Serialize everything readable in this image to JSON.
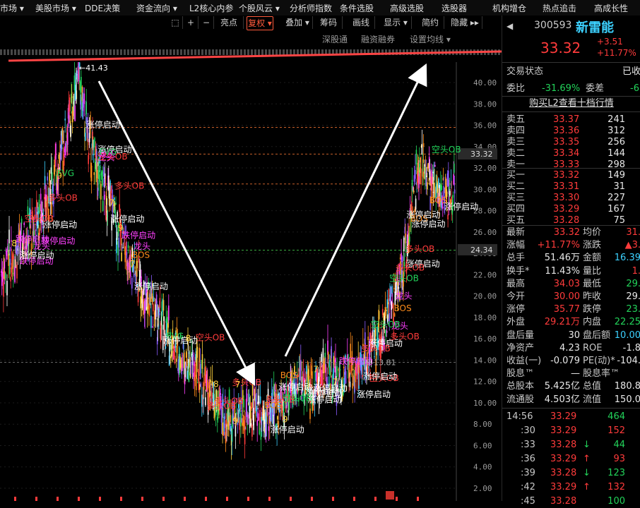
{
  "menu": [
    "市场 ▾",
    "美股市场 ▾",
    "DDE决策",
    "资金流向 ▾",
    "L2核心内参",
    "个股风云 ▾",
    "分析师指数",
    "条件选股",
    "高级选股",
    "选股器",
    "机构增仓",
    "热点追击",
    "高成长性"
  ],
  "toolbar": {
    "buttons": [
      "⬚",
      "+",
      "−",
      "亮点",
      "复权 ▾",
      "叠加 ▾",
      "筹码",
      "画线",
      "显示 ▾",
      "简约",
      "隐藏 ▸▸"
    ],
    "selected_label": "复权 ▾"
  },
  "subbar": {
    "items": [
      "深股通",
      "融资融券",
      "设置均线 ▾"
    ]
  },
  "chart": {
    "y_ticks": [
      "40.00",
      "38.00",
      "36.00",
      "34.00",
      "32.00",
      "30.00",
      "28.00",
      "26.00",
      "24.00",
      "22.00",
      "20.00",
      "18.00",
      "16.00",
      "14.00",
      "12.00",
      "10.00",
      "8.00",
      "6.00",
      "4.00",
      "2.00"
    ],
    "price_tag": "33.32",
    "price_tag2": "24.34",
    "high_label": "←41.43",
    "low_label": "8-13.81",
    "annotations": [
      "FVG",
      "空头OB",
      "多头OB",
      "涨停启动",
      "跌停启动",
      "龙头",
      "BOS",
      "7",
      "8",
      "9",
      "多头OB",
      "空头OB",
      "涨停启动"
    ]
  },
  "stock": {
    "code": "300593",
    "name": "新雷能",
    "price": "33.32",
    "change": "+3.51",
    "change_pct": "+11.77%",
    "trade_status_label": "交易状态",
    "trade_status_value": "已收",
    "webi_label": "委比",
    "webi_value": "-31.69%",
    "weicha_label": "委差",
    "weicha_value": "-6",
    "l2_link": "购买L2查看十档行情"
  },
  "asks": [
    {
      "label": "卖五",
      "price": "33.37",
      "vol": "241"
    },
    {
      "label": "卖四",
      "price": "33.36",
      "vol": "312"
    },
    {
      "label": "卖三",
      "price": "33.35",
      "vol": "256"
    },
    {
      "label": "卖二",
      "price": "33.34",
      "vol": "144"
    },
    {
      "label": "卖一",
      "price": "33.33",
      "vol": "298"
    }
  ],
  "bids": [
    {
      "label": "买一",
      "price": "33.32",
      "vol": "149"
    },
    {
      "label": "买二",
      "price": "33.31",
      "vol": "31"
    },
    {
      "label": "买三",
      "price": "33.30",
      "vol": "227"
    },
    {
      "label": "买四",
      "price": "33.29",
      "vol": "167"
    },
    {
      "label": "买五",
      "price": "33.28",
      "vol": "75"
    }
  ],
  "stats": [
    {
      "l1": "最新",
      "v1": "33.32",
      "c1": "red",
      "l2": "均价",
      "v2": "31.",
      "c2": "red"
    },
    {
      "l1": "涨幅",
      "v1": "+11.77%",
      "c1": "red",
      "l2": "涨跌",
      "v2": "▲3.",
      "c2": "red"
    },
    {
      "l1": "总手",
      "v1": "51.46万",
      "c1": "white",
      "l2": "金额",
      "v2": "16.39",
      "c2": "cyan"
    },
    {
      "l1": "换手*",
      "v1": "11.43%",
      "c1": "white",
      "l2": "量比",
      "v2": "1.",
      "c2": "red"
    },
    {
      "l1": "最高",
      "v1": "34.03",
      "c1": "red",
      "l2": "最低",
      "v2": "29.",
      "c2": "green"
    },
    {
      "l1": "今开",
      "v1": "30.00",
      "c1": "red",
      "l2": "昨收",
      "v2": "29.",
      "c2": "white"
    },
    {
      "l1": "涨停",
      "v1": "35.77",
      "c1": "red",
      "l2": "跌停",
      "v2": "23.",
      "c2": "green"
    },
    {
      "l1": "外盘",
      "v1": "29.21万",
      "c1": "red",
      "l2": "内盘",
      "v2": "22.25",
      "c2": "green"
    },
    {
      "l1": "盘后量",
      "v1": "30",
      "c1": "white",
      "l2": "盘后额",
      "v2": "10.00",
      "c2": "cyan"
    },
    {
      "l1": "净资产",
      "v1": "4.23",
      "c1": "white",
      "l2": "ROE",
      "v2": "-1.8",
      "c2": "white"
    },
    {
      "l1": "收益(一)",
      "v1": "-0.079",
      "c1": "white",
      "l2": "PE(动)*",
      "v2": "-104.",
      "c2": "white"
    },
    {
      "l1": "股息™",
      "v1": "—",
      "c1": "white",
      "l2": "股息率™",
      "v2": "",
      "c2": "white"
    },
    {
      "l1": "总股本",
      "v1": "5.425亿",
      "c1": "white",
      "l2": "总值",
      "v2": "180.8",
      "c2": "white"
    },
    {
      "l1": "流通股",
      "v1": "4.503亿",
      "c1": "white",
      "l2": "流值",
      "v2": "150.0",
      "c2": "white"
    }
  ],
  "ticks": [
    {
      "time": "14:56",
      "price": "33.29",
      "arrow": "",
      "vol": "464",
      "extra": "1"
    },
    {
      "time": ":30",
      "price": "33.29",
      "arrow": "",
      "vol": "152",
      "extra": ""
    },
    {
      "time": ":33",
      "price": "33.28",
      "arrow": "↓",
      "vol": "44",
      "extra": ""
    },
    {
      "time": ":36",
      "price": "33.29",
      "arrow": "↑",
      "vol": "93",
      "extra": ""
    },
    {
      "time": ":39",
      "price": "33.28",
      "arrow": "↓",
      "vol": "123",
      "extra": ""
    },
    {
      "time": ":42",
      "price": "33.29",
      "arrow": "↑",
      "vol": "132",
      "extra": ""
    },
    {
      "time": ":45",
      "price": "33.28",
      "arrow": "",
      "vol": "100",
      "extra": ""
    }
  ],
  "colors": {
    "up": "#ff3b3b",
    "down": "#22d35a",
    "arrow": "#ff4444",
    "white_arrow": "#ffffff"
  }
}
